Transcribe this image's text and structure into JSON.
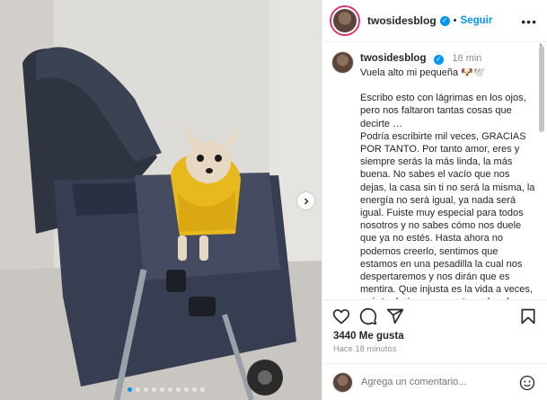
{
  "header": {
    "username": "twosidesblog",
    "dot": "•",
    "follow_label": "Seguir",
    "more_label": "•••"
  },
  "caption": {
    "username": "twosidesblog",
    "time": "18 min",
    "first_line": "Vuela alto mi pequeña 🐶🕊️",
    "paragraphs": [
      "Escribo esto con lágrimas en los ojos, pero nos faltaron tantas cosas que decirte …",
      "Podría escribirte mil veces, GRACIAS POR TANTO. Por tanto amor, eres y siempre serás la más linda, la más buena. No sabes el vacío que nos dejas, la casa sin ti no será la misma, la energía no será igual, ya nada será igual. Fuiste muy especial para todos nosotros y no sabes cómo nos duele que ya no estés. Hasta ahora no podemos creerlo, sentimos que estamos en una pesadilla la cual nos despertaremos y nos dirán que es mentira. Que injusta es la vida a veces, cuánto daríamos por retroceder el tiempo, cambiar las"
    ]
  },
  "engagement": {
    "likes": "3440 Me gusta",
    "time_ago": "Hace 18 minutos"
  },
  "comment": {
    "placeholder": "Agrega un comentario..."
  },
  "carousel": {
    "slide_count": 10,
    "active_index": 0
  },
  "icons": {
    "like": "heart-icon",
    "comment": "comment-icon",
    "share": "share-icon",
    "save": "bookmark-icon",
    "emoji": "emoji-icon",
    "next": "chevron-right-icon",
    "verified": "verified-badge-icon"
  },
  "colors": {
    "accent": "#0095f6",
    "text": "#262626",
    "muted": "#8e8e8e"
  }
}
